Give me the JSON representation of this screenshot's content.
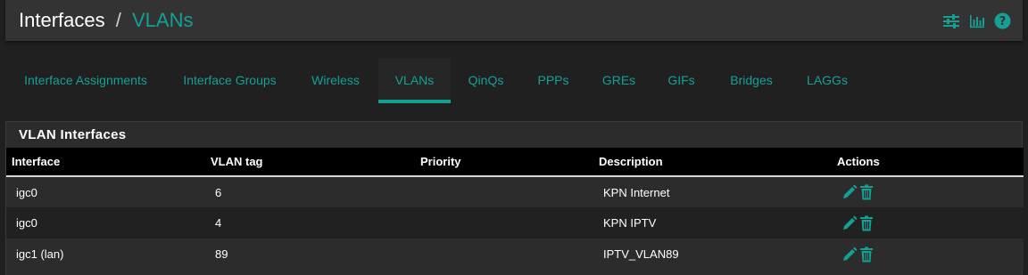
{
  "breadcrumb": {
    "main": "Interfaces",
    "separator": "/",
    "current": "VLANs"
  },
  "header_icons": [
    "sliders-icon",
    "bar-chart-icon",
    "help-icon"
  ],
  "tabs": [
    {
      "label": "Interface Assignments",
      "active": false
    },
    {
      "label": "Interface Groups",
      "active": false
    },
    {
      "label": "Wireless",
      "active": false
    },
    {
      "label": "VLANs",
      "active": true
    },
    {
      "label": "QinQs",
      "active": false
    },
    {
      "label": "PPPs",
      "active": false
    },
    {
      "label": "GREs",
      "active": false
    },
    {
      "label": "GIFs",
      "active": false
    },
    {
      "label": "Bridges",
      "active": false
    },
    {
      "label": "LAGGs",
      "active": false
    }
  ],
  "panel": {
    "title": "VLAN Interfaces",
    "columns": [
      "Interface",
      "VLAN tag",
      "Priority",
      "Description",
      "Actions"
    ],
    "rows": [
      {
        "interface": "igc0",
        "vlan_tag": "6",
        "priority": "",
        "description": "KPN Internet"
      },
      {
        "interface": "igc0",
        "vlan_tag": "4",
        "priority": "",
        "description": "KPN IPTV"
      },
      {
        "interface": "igc1 (lan)",
        "vlan_tag": "89",
        "priority": "",
        "description": "IPTV_VLAN89"
      }
    ]
  },
  "colors": {
    "accent": "#14a094",
    "background": "#202020",
    "header_bg": "#333333",
    "table_header_bg": "#000000"
  }
}
